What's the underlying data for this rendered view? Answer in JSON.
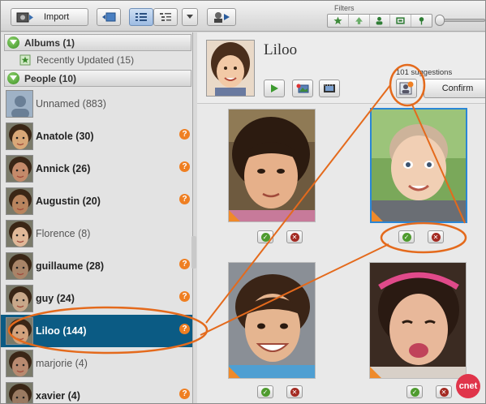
{
  "toolbar": {
    "import_label": "Import",
    "filters_label": "Filters",
    "filter_icons": [
      "star-icon",
      "flag-icon",
      "person-icon",
      "screen-icon",
      "pin-icon"
    ]
  },
  "sidebar": {
    "albums": {
      "label": "Albums (1)"
    },
    "recently_updated": "Recently Updated (15)",
    "people": {
      "label": "People (10)"
    },
    "persons": [
      {
        "label": "Unnamed (883)",
        "bold": false,
        "alert": false
      },
      {
        "label": "Anatole (30)",
        "bold": true,
        "alert": true
      },
      {
        "label": "Annick (26)",
        "bold": true,
        "alert": true
      },
      {
        "label": "Augustin (20)",
        "bold": true,
        "alert": true
      },
      {
        "label": "Florence (8)",
        "bold": false,
        "alert": false
      },
      {
        "label": "guillaume (28)",
        "bold": true,
        "alert": true
      },
      {
        "label": "guy (24)",
        "bold": true,
        "alert": true
      },
      {
        "label": "Liloo (144)",
        "bold": true,
        "alert": true,
        "selected": true
      },
      {
        "label": "marjorie (4)",
        "bold": false,
        "alert": false
      },
      {
        "label": "xavier (4)",
        "bold": true,
        "alert": true
      }
    ],
    "alert_glyph": "?"
  },
  "main": {
    "person_name": "Liloo",
    "suggestion_count": "101 suggestions",
    "confirm_label": "Confirm"
  },
  "photos": [
    {
      "id": "photo-1",
      "selected": false
    },
    {
      "id": "photo-2",
      "selected": true
    },
    {
      "id": "photo-3",
      "selected": false
    },
    {
      "id": "photo-4",
      "selected": false
    }
  ],
  "watermark": "cnet",
  "colors": {
    "selection_blue": "#0b5b84",
    "alert_orange": "#ef7f22",
    "annotation_orange": "#e46a1c",
    "accept_green": "#4e9b2e",
    "reject_red": "#a32a22"
  }
}
